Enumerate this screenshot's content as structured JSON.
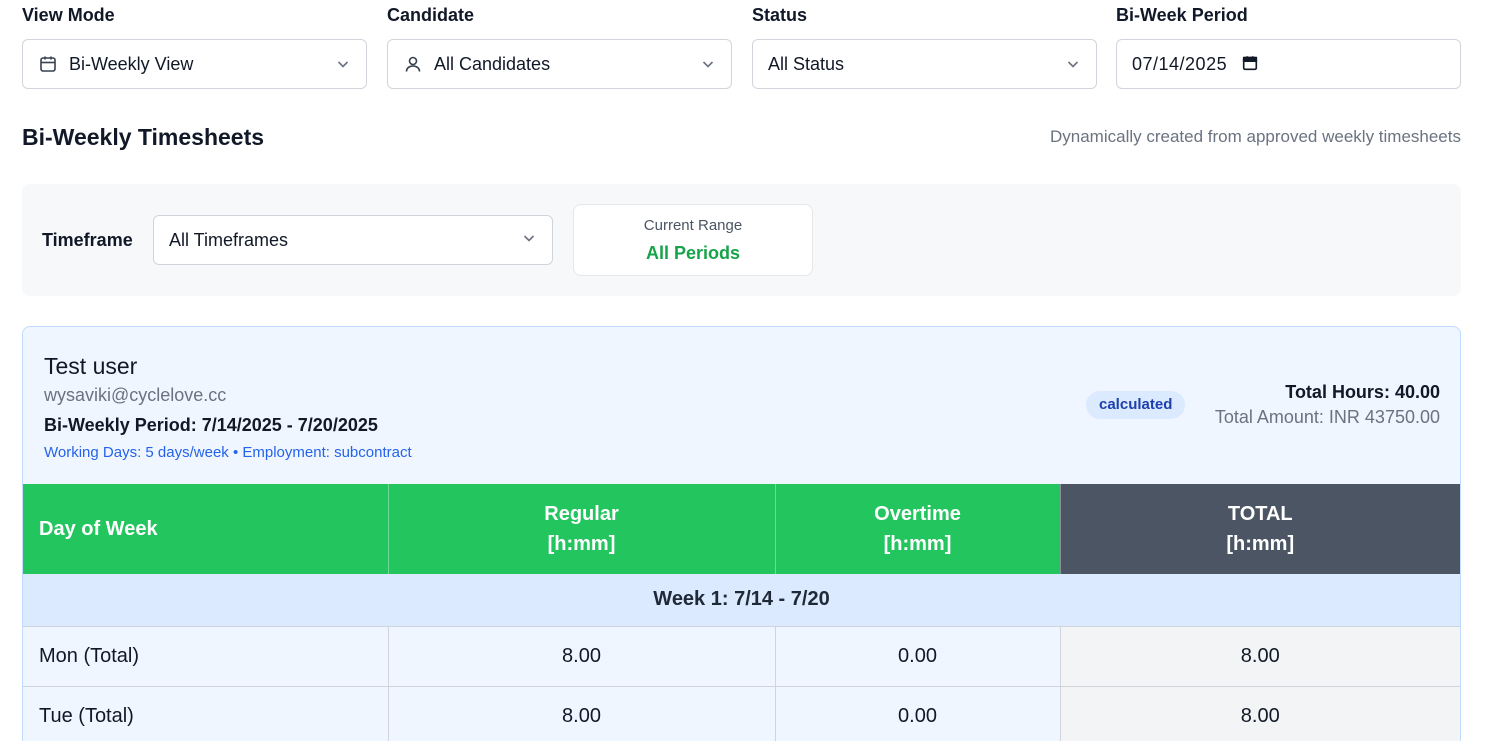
{
  "filters": {
    "view_mode": {
      "label": "View Mode",
      "value": "Bi-Weekly View",
      "icon": "calendar-icon"
    },
    "candidate": {
      "label": "Candidate",
      "value": "All Candidates",
      "icon": "user-icon"
    },
    "status": {
      "label": "Status",
      "value": "All Status"
    },
    "period": {
      "label": "Bi-Week Period",
      "value": "07/14/2025",
      "icon": "calendar-icon"
    }
  },
  "section": {
    "title": "Bi-Weekly Timesheets",
    "subtitle": "Dynamically created from approved weekly timesheets"
  },
  "timeframe": {
    "label": "Timeframe",
    "value": "All Timeframes",
    "range_label": "Current Range",
    "range_value": "All Periods"
  },
  "card": {
    "name": "Test user",
    "email": "wysaviki@cyclelove.cc",
    "period": "Bi-Weekly Period: 7/14/2025 - 7/20/2025",
    "working": "Working Days: 5 days/week • Employment: subcontract",
    "status_badge": "calculated",
    "total_hours": "Total Hours: 40.00",
    "total_amount": "Total Amount: INR 43750.00"
  },
  "table": {
    "headers": {
      "day": "Day of Week",
      "regular_1": "Regular",
      "regular_2": "[h:mm]",
      "overtime_1": "Overtime",
      "overtime_2": "[h:mm]",
      "total_1": "TOTAL",
      "total_2": "[h:mm]"
    },
    "week_label": "Week 1: 7/14 - 7/20",
    "rows": [
      {
        "day": "Mon (Total)",
        "regular": "8.00",
        "overtime": "0.00",
        "total": "8.00"
      },
      {
        "day": "Tue (Total)",
        "regular": "8.00",
        "overtime": "0.00",
        "total": "8.00"
      }
    ]
  },
  "colors": {
    "header_green": "#22c55e",
    "header_dark": "#4b5563",
    "range_green": "#16a34a",
    "link_blue": "#2563eb",
    "badge_bg": "#dbeafe"
  }
}
